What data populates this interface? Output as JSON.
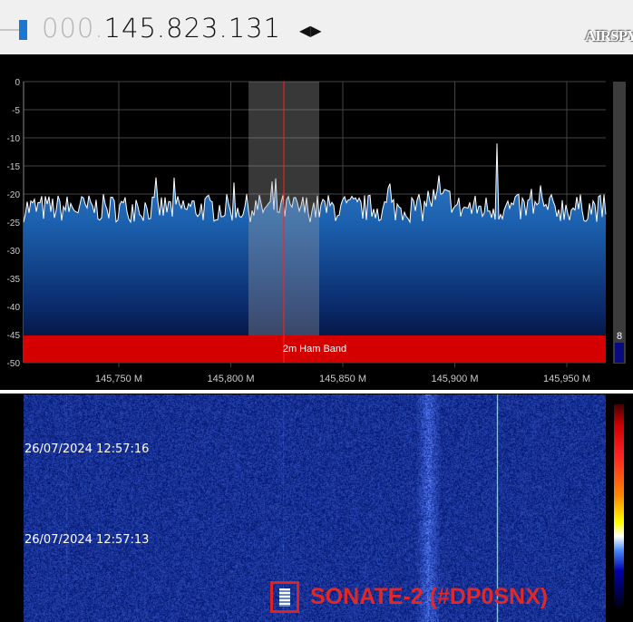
{
  "header": {
    "freq_prefix": "000.",
    "freq_main": "145.823.131",
    "tune_arrows": "◀▶",
    "logo": "AIRSPY"
  },
  "spectrum": {
    "y_ticks": [
      "0",
      "-5",
      "-10",
      "-15",
      "-20",
      "-25",
      "-30",
      "-35",
      "-40",
      "-45",
      "-50"
    ],
    "x_ticks": [
      "145,750 M",
      "145,800 M",
      "145,850 M",
      "145,900 M",
      "145,950 M"
    ],
    "band_label": "2m Ham Band",
    "level_value": "8",
    "colors": {
      "band": "#d40000",
      "cursor": "#ff2020",
      "trace": "#ffffff"
    }
  },
  "waterfall": {
    "timestamps": [
      "26/07/2024 12:57:16",
      "26/07/2024 12:57:13"
    ]
  },
  "annotation": {
    "label": "SONATE-2 (#DP0SNX)"
  }
}
